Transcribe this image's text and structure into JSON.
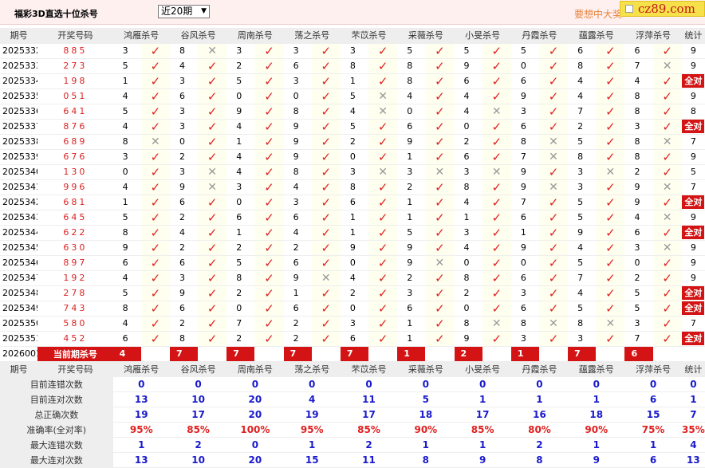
{
  "header": {
    "title": "福彩3D直选十位杀号",
    "period_select": "近20期",
    "slogan": "要想中大奖",
    "logo": "cz89.com"
  },
  "columns": {
    "issue": "期号",
    "draw": "开奖号码",
    "experts": [
      "鸿雁杀号",
      "谷风杀号",
      "周南杀号",
      "荡之杀号",
      "芣苡杀号",
      "采薇杀号",
      "小旻杀号",
      "丹霞杀号",
      "蕴露杀号",
      "浮萍杀号"
    ],
    "stat": "统计"
  },
  "rows": [
    {
      "issue": "2025332",
      "draw": "885",
      "kills": [
        [
          3,
          true
        ],
        [
          8,
          false
        ],
        [
          3,
          true
        ],
        [
          3,
          true
        ],
        [
          3,
          true
        ],
        [
          5,
          true
        ],
        [
          5,
          true
        ],
        [
          5,
          true
        ],
        [
          6,
          true
        ],
        [
          6,
          true
        ]
      ],
      "stat": "9"
    },
    {
      "issue": "2025333",
      "draw": "273",
      "kills": [
        [
          5,
          true
        ],
        [
          4,
          true
        ],
        [
          2,
          true
        ],
        [
          6,
          true
        ],
        [
          8,
          true
        ],
        [
          8,
          true
        ],
        [
          9,
          true
        ],
        [
          0,
          true
        ],
        [
          8,
          true
        ],
        [
          7,
          false
        ]
      ],
      "stat": "9"
    },
    {
      "issue": "2025334",
      "draw": "198",
      "kills": [
        [
          1,
          true
        ],
        [
          3,
          true
        ],
        [
          5,
          true
        ],
        [
          3,
          true
        ],
        [
          1,
          true
        ],
        [
          8,
          true
        ],
        [
          6,
          true
        ],
        [
          6,
          true
        ],
        [
          4,
          true
        ],
        [
          4,
          true
        ]
      ],
      "stat": "全对"
    },
    {
      "issue": "2025335",
      "draw": "051",
      "kills": [
        [
          4,
          true
        ],
        [
          6,
          true
        ],
        [
          0,
          true
        ],
        [
          0,
          true
        ],
        [
          5,
          false
        ],
        [
          4,
          true
        ],
        [
          4,
          true
        ],
        [
          9,
          true
        ],
        [
          4,
          true
        ],
        [
          8,
          true
        ]
      ],
      "stat": "9"
    },
    {
      "issue": "2025336",
      "draw": "641",
      "kills": [
        [
          5,
          true
        ],
        [
          3,
          true
        ],
        [
          9,
          true
        ],
        [
          8,
          true
        ],
        [
          4,
          false
        ],
        [
          0,
          true
        ],
        [
          4,
          false
        ],
        [
          3,
          true
        ],
        [
          7,
          true
        ],
        [
          8,
          true
        ]
      ],
      "stat": "8"
    },
    {
      "issue": "2025337",
      "draw": "876",
      "kills": [
        [
          4,
          true
        ],
        [
          3,
          true
        ],
        [
          4,
          true
        ],
        [
          9,
          true
        ],
        [
          5,
          true
        ],
        [
          6,
          true
        ],
        [
          0,
          true
        ],
        [
          6,
          true
        ],
        [
          2,
          true
        ],
        [
          3,
          true
        ]
      ],
      "stat": "全对"
    },
    {
      "issue": "2025338",
      "draw": "689",
      "kills": [
        [
          8,
          false
        ],
        [
          0,
          true
        ],
        [
          1,
          true
        ],
        [
          9,
          true
        ],
        [
          2,
          true
        ],
        [
          9,
          true
        ],
        [
          2,
          true
        ],
        [
          8,
          false
        ],
        [
          5,
          true
        ],
        [
          8,
          false
        ]
      ],
      "stat": "7"
    },
    {
      "issue": "2025339",
      "draw": "676",
      "kills": [
        [
          3,
          true
        ],
        [
          2,
          true
        ],
        [
          4,
          true
        ],
        [
          9,
          true
        ],
        [
          0,
          true
        ],
        [
          1,
          true
        ],
        [
          6,
          true
        ],
        [
          7,
          false
        ],
        [
          8,
          true
        ],
        [
          8,
          true
        ]
      ],
      "stat": "9"
    },
    {
      "issue": "2025340",
      "draw": "130",
      "kills": [
        [
          0,
          true
        ],
        [
          3,
          false
        ],
        [
          4,
          true
        ],
        [
          8,
          true
        ],
        [
          3,
          false
        ],
        [
          3,
          false
        ],
        [
          3,
          false
        ],
        [
          9,
          true
        ],
        [
          3,
          false
        ],
        [
          2,
          true
        ]
      ],
      "stat": "5"
    },
    {
      "issue": "2025341",
      "draw": "996",
      "kills": [
        [
          4,
          true
        ],
        [
          9,
          false
        ],
        [
          3,
          true
        ],
        [
          4,
          true
        ],
        [
          8,
          true
        ],
        [
          2,
          true
        ],
        [
          8,
          true
        ],
        [
          9,
          false
        ],
        [
          3,
          true
        ],
        [
          9,
          false
        ]
      ],
      "stat": "7"
    },
    {
      "issue": "2025342",
      "draw": "681",
      "kills": [
        [
          1,
          true
        ],
        [
          6,
          true
        ],
        [
          0,
          true
        ],
        [
          3,
          true
        ],
        [
          6,
          true
        ],
        [
          1,
          true
        ],
        [
          4,
          true
        ],
        [
          7,
          true
        ],
        [
          5,
          true
        ],
        [
          9,
          true
        ]
      ],
      "stat": "全对"
    },
    {
      "issue": "2025343",
      "draw": "645",
      "kills": [
        [
          5,
          true
        ],
        [
          2,
          true
        ],
        [
          6,
          true
        ],
        [
          6,
          true
        ],
        [
          1,
          true
        ],
        [
          1,
          true
        ],
        [
          1,
          true
        ],
        [
          6,
          true
        ],
        [
          5,
          true
        ],
        [
          4,
          false
        ]
      ],
      "stat": "9"
    },
    {
      "issue": "2025344",
      "draw": "622",
      "kills": [
        [
          8,
          true
        ],
        [
          4,
          true
        ],
        [
          1,
          true
        ],
        [
          4,
          true
        ],
        [
          1,
          true
        ],
        [
          5,
          true
        ],
        [
          3,
          true
        ],
        [
          1,
          true
        ],
        [
          9,
          true
        ],
        [
          6,
          true
        ]
      ],
      "stat": "全对"
    },
    {
      "issue": "2025345",
      "draw": "630",
      "kills": [
        [
          9,
          true
        ],
        [
          2,
          true
        ],
        [
          2,
          true
        ],
        [
          2,
          true
        ],
        [
          9,
          true
        ],
        [
          9,
          true
        ],
        [
          4,
          true
        ],
        [
          9,
          true
        ],
        [
          4,
          true
        ],
        [
          3,
          false
        ]
      ],
      "stat": "9"
    },
    {
      "issue": "2025346",
      "draw": "897",
      "kills": [
        [
          6,
          true
        ],
        [
          6,
          true
        ],
        [
          5,
          true
        ],
        [
          6,
          true
        ],
        [
          0,
          true
        ],
        [
          9,
          false
        ],
        [
          0,
          true
        ],
        [
          0,
          true
        ],
        [
          5,
          true
        ],
        [
          0,
          true
        ]
      ],
      "stat": "9"
    },
    {
      "issue": "2025347",
      "draw": "192",
      "kills": [
        [
          4,
          true
        ],
        [
          3,
          true
        ],
        [
          8,
          true
        ],
        [
          9,
          false
        ],
        [
          4,
          true
        ],
        [
          2,
          true
        ],
        [
          8,
          true
        ],
        [
          6,
          true
        ],
        [
          7,
          true
        ],
        [
          2,
          true
        ]
      ],
      "stat": "9"
    },
    {
      "issue": "2025348",
      "draw": "278",
      "kills": [
        [
          5,
          true
        ],
        [
          9,
          true
        ],
        [
          2,
          true
        ],
        [
          1,
          true
        ],
        [
          2,
          true
        ],
        [
          3,
          true
        ],
        [
          2,
          true
        ],
        [
          3,
          true
        ],
        [
          4,
          true
        ],
        [
          5,
          true
        ]
      ],
      "stat": "全对"
    },
    {
      "issue": "2025349",
      "draw": "743",
      "kills": [
        [
          8,
          true
        ],
        [
          6,
          true
        ],
        [
          0,
          true
        ],
        [
          6,
          true
        ],
        [
          0,
          true
        ],
        [
          6,
          true
        ],
        [
          0,
          true
        ],
        [
          6,
          true
        ],
        [
          5,
          true
        ],
        [
          5,
          true
        ]
      ],
      "stat": "全对"
    },
    {
      "issue": "2025350",
      "draw": "580",
      "kills": [
        [
          4,
          true
        ],
        [
          2,
          true
        ],
        [
          7,
          true
        ],
        [
          2,
          true
        ],
        [
          3,
          true
        ],
        [
          1,
          true
        ],
        [
          8,
          false
        ],
        [
          8,
          false
        ],
        [
          8,
          false
        ],
        [
          3,
          true
        ]
      ],
      "stat": "7"
    },
    {
      "issue": "2025351",
      "draw": "452",
      "kills": [
        [
          6,
          true
        ],
        [
          8,
          true
        ],
        [
          2,
          true
        ],
        [
          2,
          true
        ],
        [
          6,
          true
        ],
        [
          1,
          true
        ],
        [
          9,
          true
        ],
        [
          3,
          true
        ],
        [
          3,
          true
        ],
        [
          7,
          true
        ]
      ],
      "stat": "全对"
    }
  ],
  "current": {
    "issue": "2026001",
    "label": "当前期杀号",
    "kills": [
      4,
      7,
      7,
      7,
      7,
      1,
      2,
      1,
      7,
      6
    ]
  },
  "stats": [
    {
      "label": "目前连错次数",
      "values": [
        "0",
        "0",
        "0",
        "0",
        "0",
        "0",
        "0",
        "0",
        "0",
        "0"
      ],
      "total": "0",
      "red": false
    },
    {
      "label": "目前连对次数",
      "values": [
        "13",
        "10",
        "20",
        "4",
        "11",
        "5",
        "1",
        "1",
        "1",
        "6"
      ],
      "total": "1",
      "red": false
    },
    {
      "label": "总正确次数",
      "values": [
        "19",
        "17",
        "20",
        "19",
        "17",
        "18",
        "17",
        "16",
        "18",
        "15"
      ],
      "total": "7",
      "red": false
    },
    {
      "label": "准确率(全对率)",
      "values": [
        "95%",
        "85%",
        "100%",
        "95%",
        "85%",
        "90%",
        "85%",
        "80%",
        "90%",
        "75%"
      ],
      "total": "35%",
      "red": true
    },
    {
      "label": "最大连错次数",
      "values": [
        "1",
        "2",
        "0",
        "1",
        "2",
        "1",
        "1",
        "2",
        "1",
        "1"
      ],
      "total": "4",
      "red": false
    },
    {
      "label": "最大连对次数",
      "values": [
        "13",
        "10",
        "20",
        "15",
        "11",
        "8",
        "9",
        "8",
        "9",
        "6"
      ],
      "total": "13",
      "red": false
    }
  ],
  "icons": {
    "correct": "check-icon",
    "wrong": "cross-icon"
  },
  "colors": {
    "correct": "#e02020",
    "wrong": "#999999",
    "highlight": "#d41414",
    "stat_value": "#1a1acc"
  }
}
